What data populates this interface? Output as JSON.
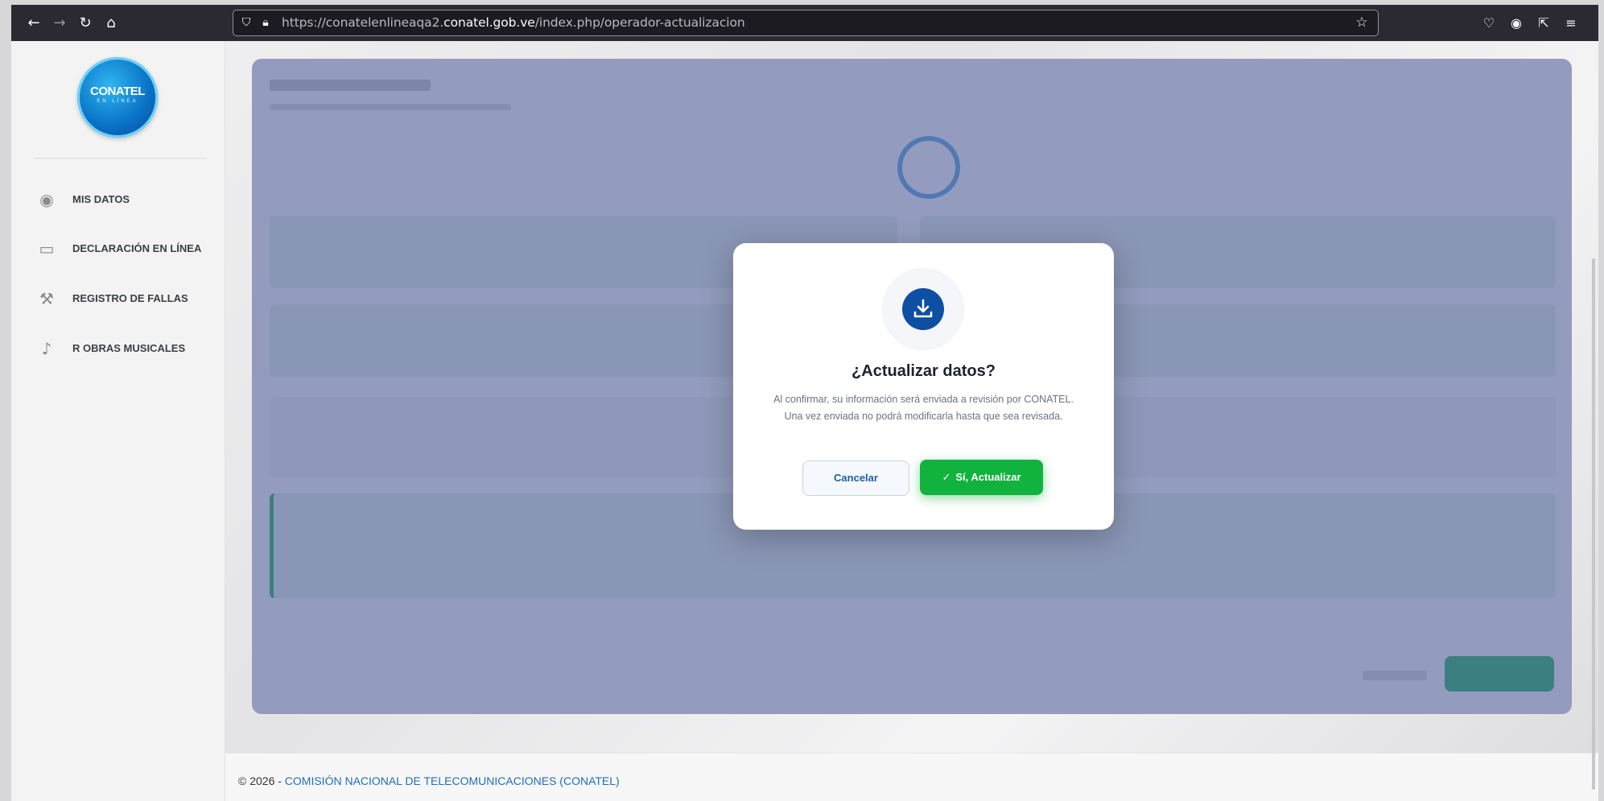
{
  "browser": {
    "url_prefix": "https://conatelenlineaqa2.",
    "url_host": "conatel.gob.ve",
    "url_path": "/index.php/operador-actualizacion"
  },
  "sidebar": {
    "logo": {
      "text": "CONATEL",
      "sub": "EN LÍNEA"
    },
    "items": [
      {
        "label": "MIS DATOS",
        "icon": "user-circle-icon"
      },
      {
        "label": "DECLARACIÓN EN LÍNEA",
        "icon": "laptop-icon"
      },
      {
        "label": "REGISTRO DE FALLAS",
        "icon": "wrench-icon"
      },
      {
        "label": "R OBRAS MUSICALES",
        "icon": "music-note-icon"
      }
    ]
  },
  "modal": {
    "title": "¿Actualizar datos?",
    "body": "Al confirmar, su información será enviada a revisión por CONATEL. Una vez enviada no podrá modificarla hasta que sea revisada.",
    "cancel_label": "Cancelar",
    "confirm_label": "Sí, Actualizar",
    "icon": "download-icon"
  },
  "footer": {
    "prefix": "© 2026 - ",
    "org": "COMISIÓN NACIONAL DE TELECOMUNICACIONES (CONATEL)"
  },
  "colors": {
    "accent": "#0d4fa3",
    "confirm": "#12b23f",
    "overlay": "#5060a0"
  }
}
